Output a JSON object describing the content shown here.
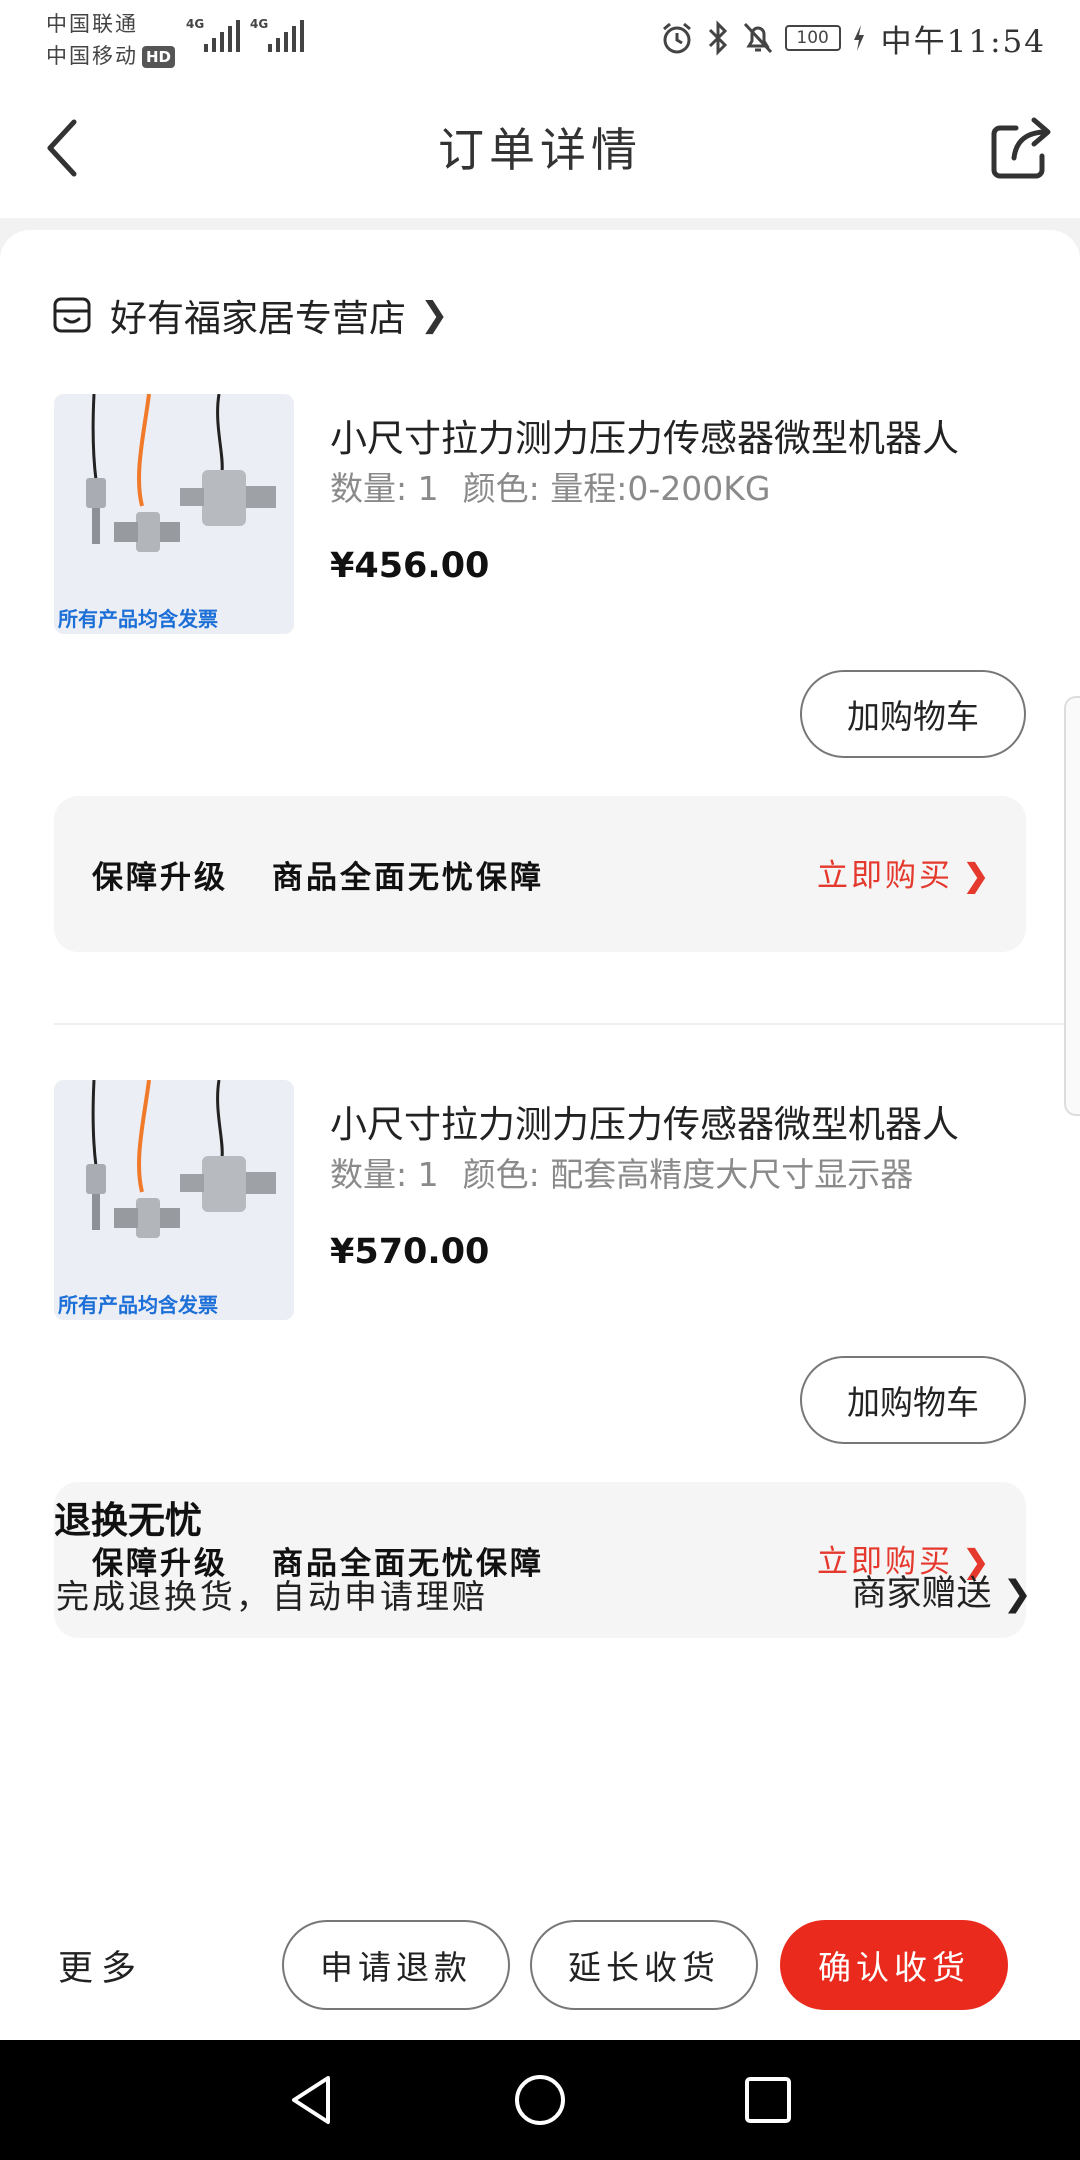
{
  "status_bar": {
    "carrier1": "中国联通",
    "carrier2": "中国移动",
    "hd": "HD",
    "network1": "4G",
    "network2": "4G",
    "battery": "100",
    "time": "中午11:54"
  },
  "header": {
    "title": "订单详情"
  },
  "store": {
    "name": "好有福家居专营店",
    "arrow": "❯"
  },
  "products": [
    {
      "title": "小尺寸拉力测力压力传感器微型机器人",
      "qty_label": "数量: 1",
      "variant_label": "颜色: 量程:0-200KG",
      "price": "¥456.00",
      "image_caption": "所有产品均含发票",
      "cart_button": "加购物车"
    },
    {
      "title": "小尺寸拉力测力压力传感器微型机器人",
      "qty_label": "数量: 1",
      "variant_label": "颜色: 配套高精度大尺寸显示器",
      "price": "¥570.00",
      "image_caption": "所有产品均含发票",
      "cart_button": "加购物车"
    }
  ],
  "guarantee": {
    "label": "保障升级",
    "desc": "商品全面无忧保障",
    "buy": "立即购买",
    "arrow": "❯"
  },
  "return_section": {
    "title": "退换无忧",
    "desc": "完成退换货，自动申请理赔",
    "link": "商家赠送",
    "arrow": "❯"
  },
  "action_bar": {
    "more": "更多",
    "refund": "申请退款",
    "extend": "延长收货",
    "confirm": "确认收货"
  },
  "colors": {
    "accent": "#ea2a1c",
    "guarantee_link": "#e4392c",
    "caption_blue": "#1d6fd8"
  }
}
